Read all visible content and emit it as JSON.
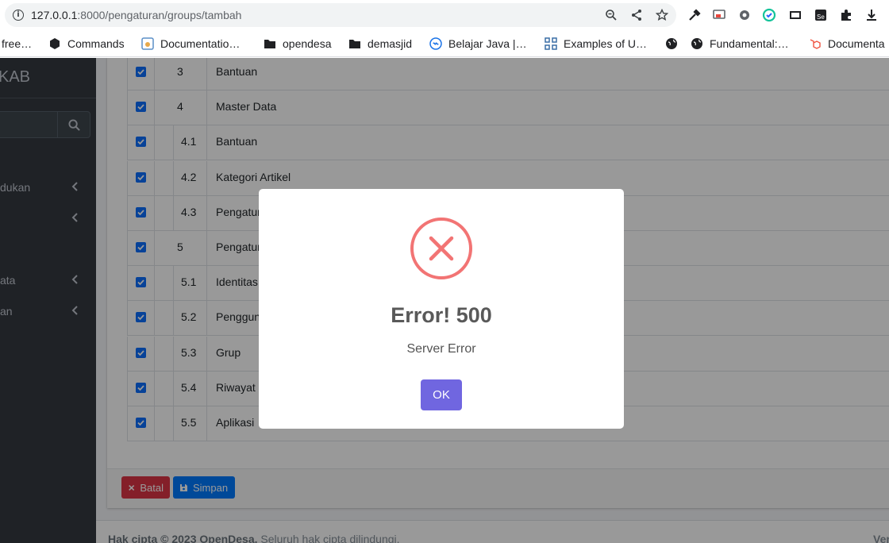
{
  "browser": {
    "url_host": "127.0.0.1",
    "url_rest": ":8000/pengaturan/groups/tambah",
    "bookmarks": [
      {
        "label": "free…",
        "icon": "bookmark-icon"
      },
      {
        "label": "Commands",
        "icon": "cube-icon"
      },
      {
        "label": "Documentatio…",
        "icon": "doc-icon"
      },
      {
        "label": "opendesa",
        "icon": "folder-icon"
      },
      {
        "label": "demasjid",
        "icon": "folder-icon"
      },
      {
        "label": "Belajar Java |…",
        "icon": "wave-icon"
      },
      {
        "label": "Examples of U…",
        "icon": "grid-icon"
      },
      {
        "label": "",
        "icon": "globe-icon"
      },
      {
        "label": "Fundamental:…",
        "icon": "globe-icon"
      },
      {
        "label": "Documenta",
        "icon": "laravel-icon"
      }
    ]
  },
  "sidebar": {
    "brand": "KAB",
    "items": [
      {
        "label": "dukan"
      },
      {
        "label": ""
      },
      {
        "label": "ata"
      },
      {
        "label": "an"
      }
    ]
  },
  "table": {
    "rows": [
      {
        "num": "3",
        "name": "Bantuan",
        "sub": false,
        "checked": true
      },
      {
        "num": "4",
        "name": "Master Data",
        "sub": false,
        "checked": true
      },
      {
        "num": "4.1",
        "name": "Bantuan",
        "sub": true,
        "checked": true
      },
      {
        "num": "4.2",
        "name": "Kategori Artikel",
        "sub": true,
        "checked": true
      },
      {
        "num": "4.3",
        "name": "Pengatur",
        "sub": true,
        "checked": true
      },
      {
        "num": "5",
        "name": "Pengatur",
        "sub": false,
        "checked": true
      },
      {
        "num": "5.1",
        "name": "Identitas",
        "sub": true,
        "checked": true
      },
      {
        "num": "5.2",
        "name": "Penggun",
        "sub": true,
        "checked": true
      },
      {
        "num": "5.3",
        "name": "Grup",
        "sub": true,
        "checked": true
      },
      {
        "num": "5.4",
        "name": "Riwayat",
        "sub": true,
        "checked": true
      },
      {
        "num": "5.5",
        "name": "Aplikasi",
        "sub": true,
        "checked": true
      }
    ]
  },
  "actions": {
    "cancel": "Batal",
    "save": "Simpan"
  },
  "footer": {
    "copyright": "Hak cipta © 2023 OpenDesa.",
    "rights": " Seluruh hak cipta dilindungi.",
    "version": "Ver"
  },
  "modal": {
    "title": "Error! 500",
    "message": "Server Error",
    "ok": "OK"
  },
  "colors": {
    "error": "#f27474",
    "ok_button": "#7066e0",
    "primary": "#007bff",
    "danger": "#dc3545",
    "sidebar": "#343a40"
  }
}
